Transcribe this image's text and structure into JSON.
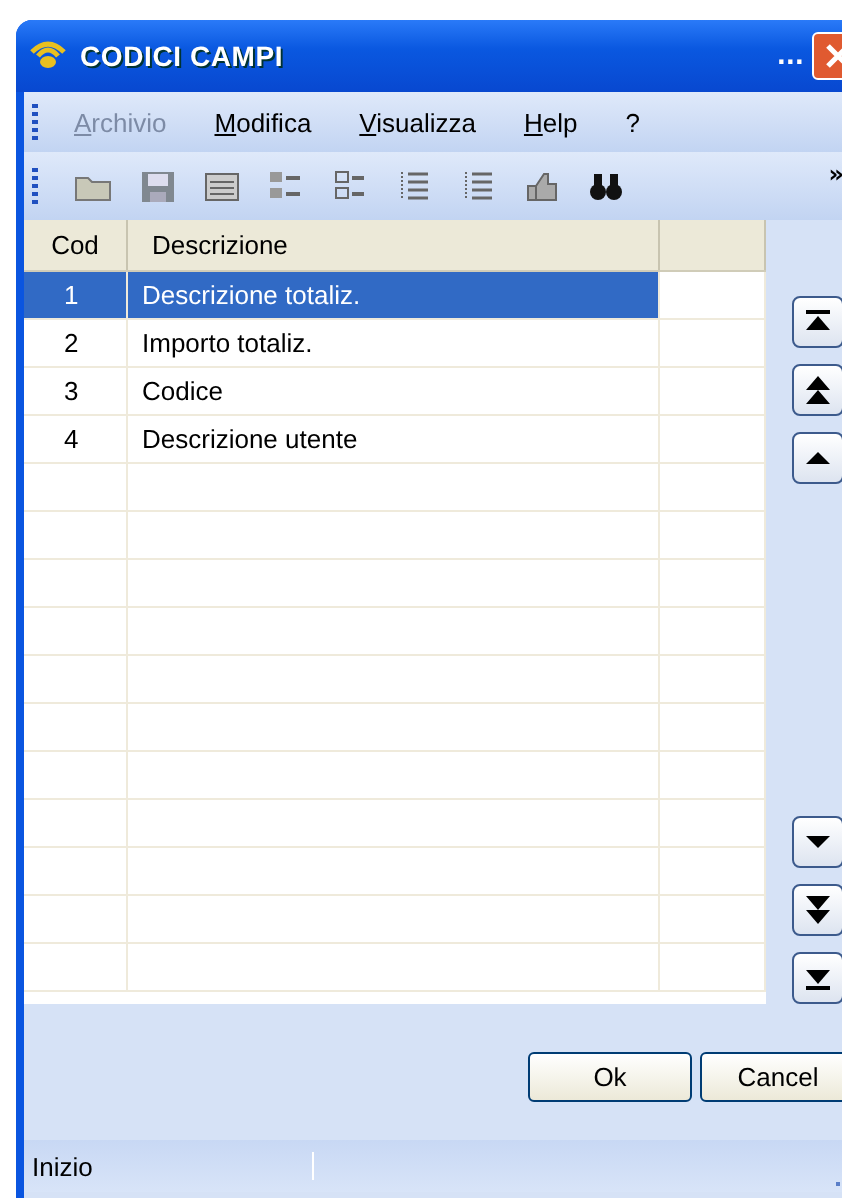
{
  "window": {
    "title": "CODICI CAMPI",
    "overflow": "..."
  },
  "menu": [
    {
      "label": "Archivio",
      "disabled": true
    },
    {
      "label": "Modifica",
      "disabled": false
    },
    {
      "label": "Visualizza",
      "disabled": false
    },
    {
      "label": "Help",
      "disabled": false
    },
    {
      "label": "?",
      "disabled": false
    }
  ],
  "toolbar": {
    "more": "»"
  },
  "table": {
    "columns": [
      "Cod",
      "Descrizione"
    ],
    "rows": [
      {
        "cod": "1",
        "descrizione": "Descrizione totaliz.",
        "selected": true
      },
      {
        "cod": "2",
        "descrizione": "Importo totaliz.",
        "selected": false
      },
      {
        "cod": "3",
        "descrizione": "Codice",
        "selected": false
      },
      {
        "cod": "4",
        "descrizione": "Descrizione utente",
        "selected": false
      }
    ]
  },
  "buttons": [
    {
      "label": "Ok"
    },
    {
      "label": "Cancel"
    }
  ],
  "status_bar": {
    "text": "Inizio"
  }
}
